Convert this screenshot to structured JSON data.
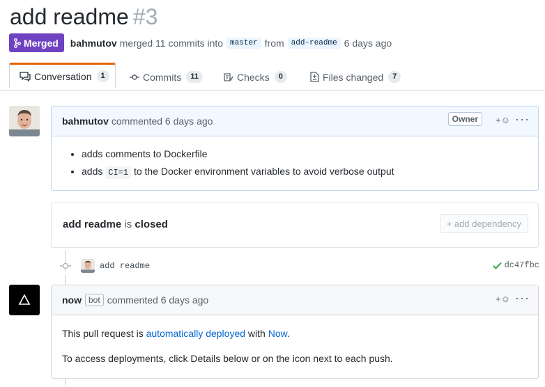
{
  "pr": {
    "title": "add readme",
    "number": "#3",
    "state": "Merged",
    "author": "bahmutov",
    "action": "merged 11 commits into",
    "base_branch": "master",
    "from_word": "from",
    "head_branch": "add-readme",
    "time": "6 days ago"
  },
  "tabs": [
    {
      "label": "Conversation",
      "count": "1"
    },
    {
      "label": "Commits",
      "count": "11"
    },
    {
      "label": "Checks",
      "count": "0"
    },
    {
      "label": "Files changed",
      "count": "7"
    }
  ],
  "comment1": {
    "author": "bahmutov",
    "meta": "commented 6 days ago",
    "role": "Owner",
    "react": "+☺",
    "menu": "···",
    "bullet1": "adds comments to Dockerfile",
    "bullet2_pre": "adds",
    "bullet2_code": "CI=1",
    "bullet2_post": "to the Docker environment variables to avoid verbose output"
  },
  "dependency": {
    "name": "add readme",
    "is_word": "is",
    "state": "closed",
    "button": "+ add dependency"
  },
  "commit": {
    "message": "add readme",
    "sha": "dc47fbc"
  },
  "comment2": {
    "author": "now",
    "badge": "bot",
    "meta": "commented 6 days ago",
    "react": "+☺",
    "menu": "···",
    "p1_pre": "This pull request is",
    "p1_link1": "automatically deployed",
    "p1_mid": "with",
    "p1_link2": "Now",
    "p1_end": ".",
    "p2": "To access deployments, click Details below or on the icon next to each push."
  },
  "colors": {
    "merged": "#6f42c1",
    "tab_accent": "#e36209",
    "link": "#0366d6",
    "success": "#28a745"
  }
}
